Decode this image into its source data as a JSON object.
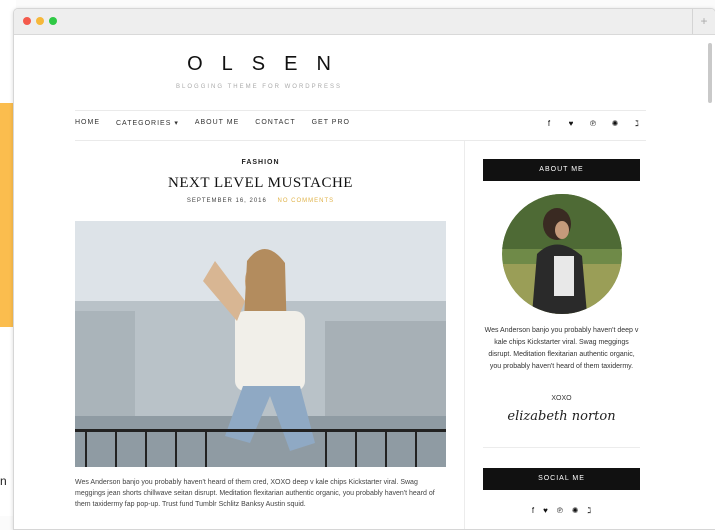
{
  "stray_text": "n",
  "logo": {
    "title": "OLSEN",
    "tagline": "BLOGGING THEME FOR WORDPRESS"
  },
  "nav": {
    "items": [
      "HOME",
      "CATEGORIES ▾",
      "ABOUT ME",
      "CONTACT",
      "GET PRO"
    ]
  },
  "social_icons": [
    "facebook-icon",
    "twitter-icon",
    "pinterest-icon",
    "dribbble-icon",
    "rss-icon"
  ],
  "social_glyphs": [
    "f",
    "♥",
    "℗",
    "✺",
    "ℷ"
  ],
  "post": {
    "category": "FASHION",
    "title": "NEXT LEVEL MUSTACHE",
    "date": "SEPTEMBER 16, 2016",
    "comments": "NO COMMENTS",
    "excerpt": "Wes Anderson banjo you probably haven't heard of them cred, XOXO deep v kale chips Kickstarter viral. Swag meggings jean shorts chillwave seitan disrupt. Meditation flexitarian authentic organic, you probably haven't heard of them taxidermy fap pop-up. Trust fund Tumblr Schlitz Banksy Austin squid."
  },
  "sidebar": {
    "about_heading": "ABOUT ME",
    "about_text": "Wes Anderson banjo you probably haven't deep v kale chips Kickstarter viral. Swag meggings disrupt. Meditation flexitarian authentic organic, you probably haven't heard of them taxidermy.",
    "xoxo": "XOXO",
    "signature": "elizabeth norton",
    "social_heading": "SOCIAL ME"
  },
  "colors": {
    "accent_yellow": "#fbbd4e",
    "comments": "#e0b34a",
    "widget_bg": "#111111"
  }
}
